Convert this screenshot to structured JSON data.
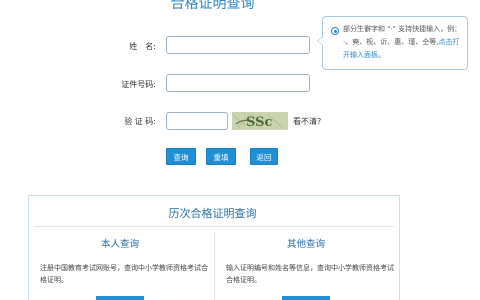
{
  "header": {
    "title": "合格证明查询"
  },
  "form": {
    "name_label": "姓　名:",
    "id_label": "证件号码:",
    "captcha_label": "验 证 码:",
    "name_value": "",
    "id_value": "",
    "captcha_value": "",
    "captcha_text": "SSc",
    "refresh_text": "看不清?"
  },
  "hint": {
    "text": "部分生僻字和 \"·\" 支持快捷输入，例：·、奭、枧、䜣、惠、瑾、仝等,",
    "link": "点击打开输入面板。"
  },
  "buttons": {
    "query": "查询",
    "reset": "重填",
    "back": "返回"
  },
  "history": {
    "title": "历次合格证明查询",
    "self": {
      "title": "本人查询",
      "desc": "注册中国教育考试网账号，查询中小学教师资格考试合格证明。"
    },
    "other": {
      "title": "其他查询",
      "desc": "输入证明编号和姓名等信息，查询中小学教师资格考试合格证明。"
    }
  },
  "colors": {
    "accent": "#1f8fd6",
    "title": "#2a86c6"
  }
}
